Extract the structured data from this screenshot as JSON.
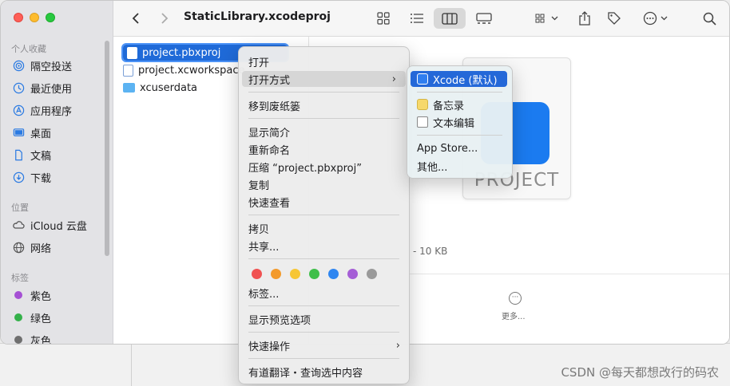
{
  "sidebar": {
    "favorites_label": "个人收藏",
    "favorites": [
      {
        "label": "隔空投送",
        "icon": "airdrop-icon"
      },
      {
        "label": "最近使用",
        "icon": "clock-icon"
      },
      {
        "label": "应用程序",
        "icon": "applications-icon"
      },
      {
        "label": "桌面",
        "icon": "desktop-icon"
      },
      {
        "label": "文稿",
        "icon": "document-icon"
      },
      {
        "label": "下载",
        "icon": "download-icon"
      }
    ],
    "locations_label": "位置",
    "locations": [
      {
        "label": "iCloud 云盘",
        "icon": "cloud-icon"
      },
      {
        "label": "网络",
        "icon": "network-icon"
      }
    ],
    "tags_label": "标签",
    "tags": [
      {
        "label": "紫色",
        "color": "#a550d4"
      },
      {
        "label": "绿色",
        "color": "#34b14a"
      },
      {
        "label": "灰色",
        "color": "#8a8a8a"
      }
    ]
  },
  "toolbar": {
    "title": "StaticLibrary.xcodeproj"
  },
  "files": [
    {
      "name": "project.pbxproj",
      "selected": true
    },
    {
      "name": "project.xcworkspace",
      "selected": false
    },
    {
      "name": "xcuserdata",
      "selected": false
    }
  ],
  "preview": {
    "icon_label": "PROJECT",
    "size_text": "- 10 KB",
    "more_label": "更多..."
  },
  "context_menu": {
    "open": "打开",
    "open_with": "打开方式",
    "trash": "移到废纸篓",
    "get_info": "显示简介",
    "rename": "重新命名",
    "compress": "压缩 “project.pbxproj”",
    "duplicate": "复制",
    "quick_look": "快速查看",
    "copy": "拷贝",
    "share": "共享...",
    "tag_colors": [
      "#f05252",
      "#f39a2b",
      "#f7c634",
      "#3fbf4a",
      "#2f86f0",
      "#a55ed6",
      "#9a9a9a"
    ],
    "tags": "标签...",
    "preview_options": "显示预览选项",
    "quick_actions": "快速操作",
    "translate": "有道翻译・查询选中内容"
  },
  "open_with_menu": {
    "xcode": "Xcode (默认)",
    "notes": "备忘录",
    "textedit": "文本编辑",
    "app_store": "App Store...",
    "other": "其他..."
  },
  "watermark": "CSDN @每天都想改行的码农"
}
